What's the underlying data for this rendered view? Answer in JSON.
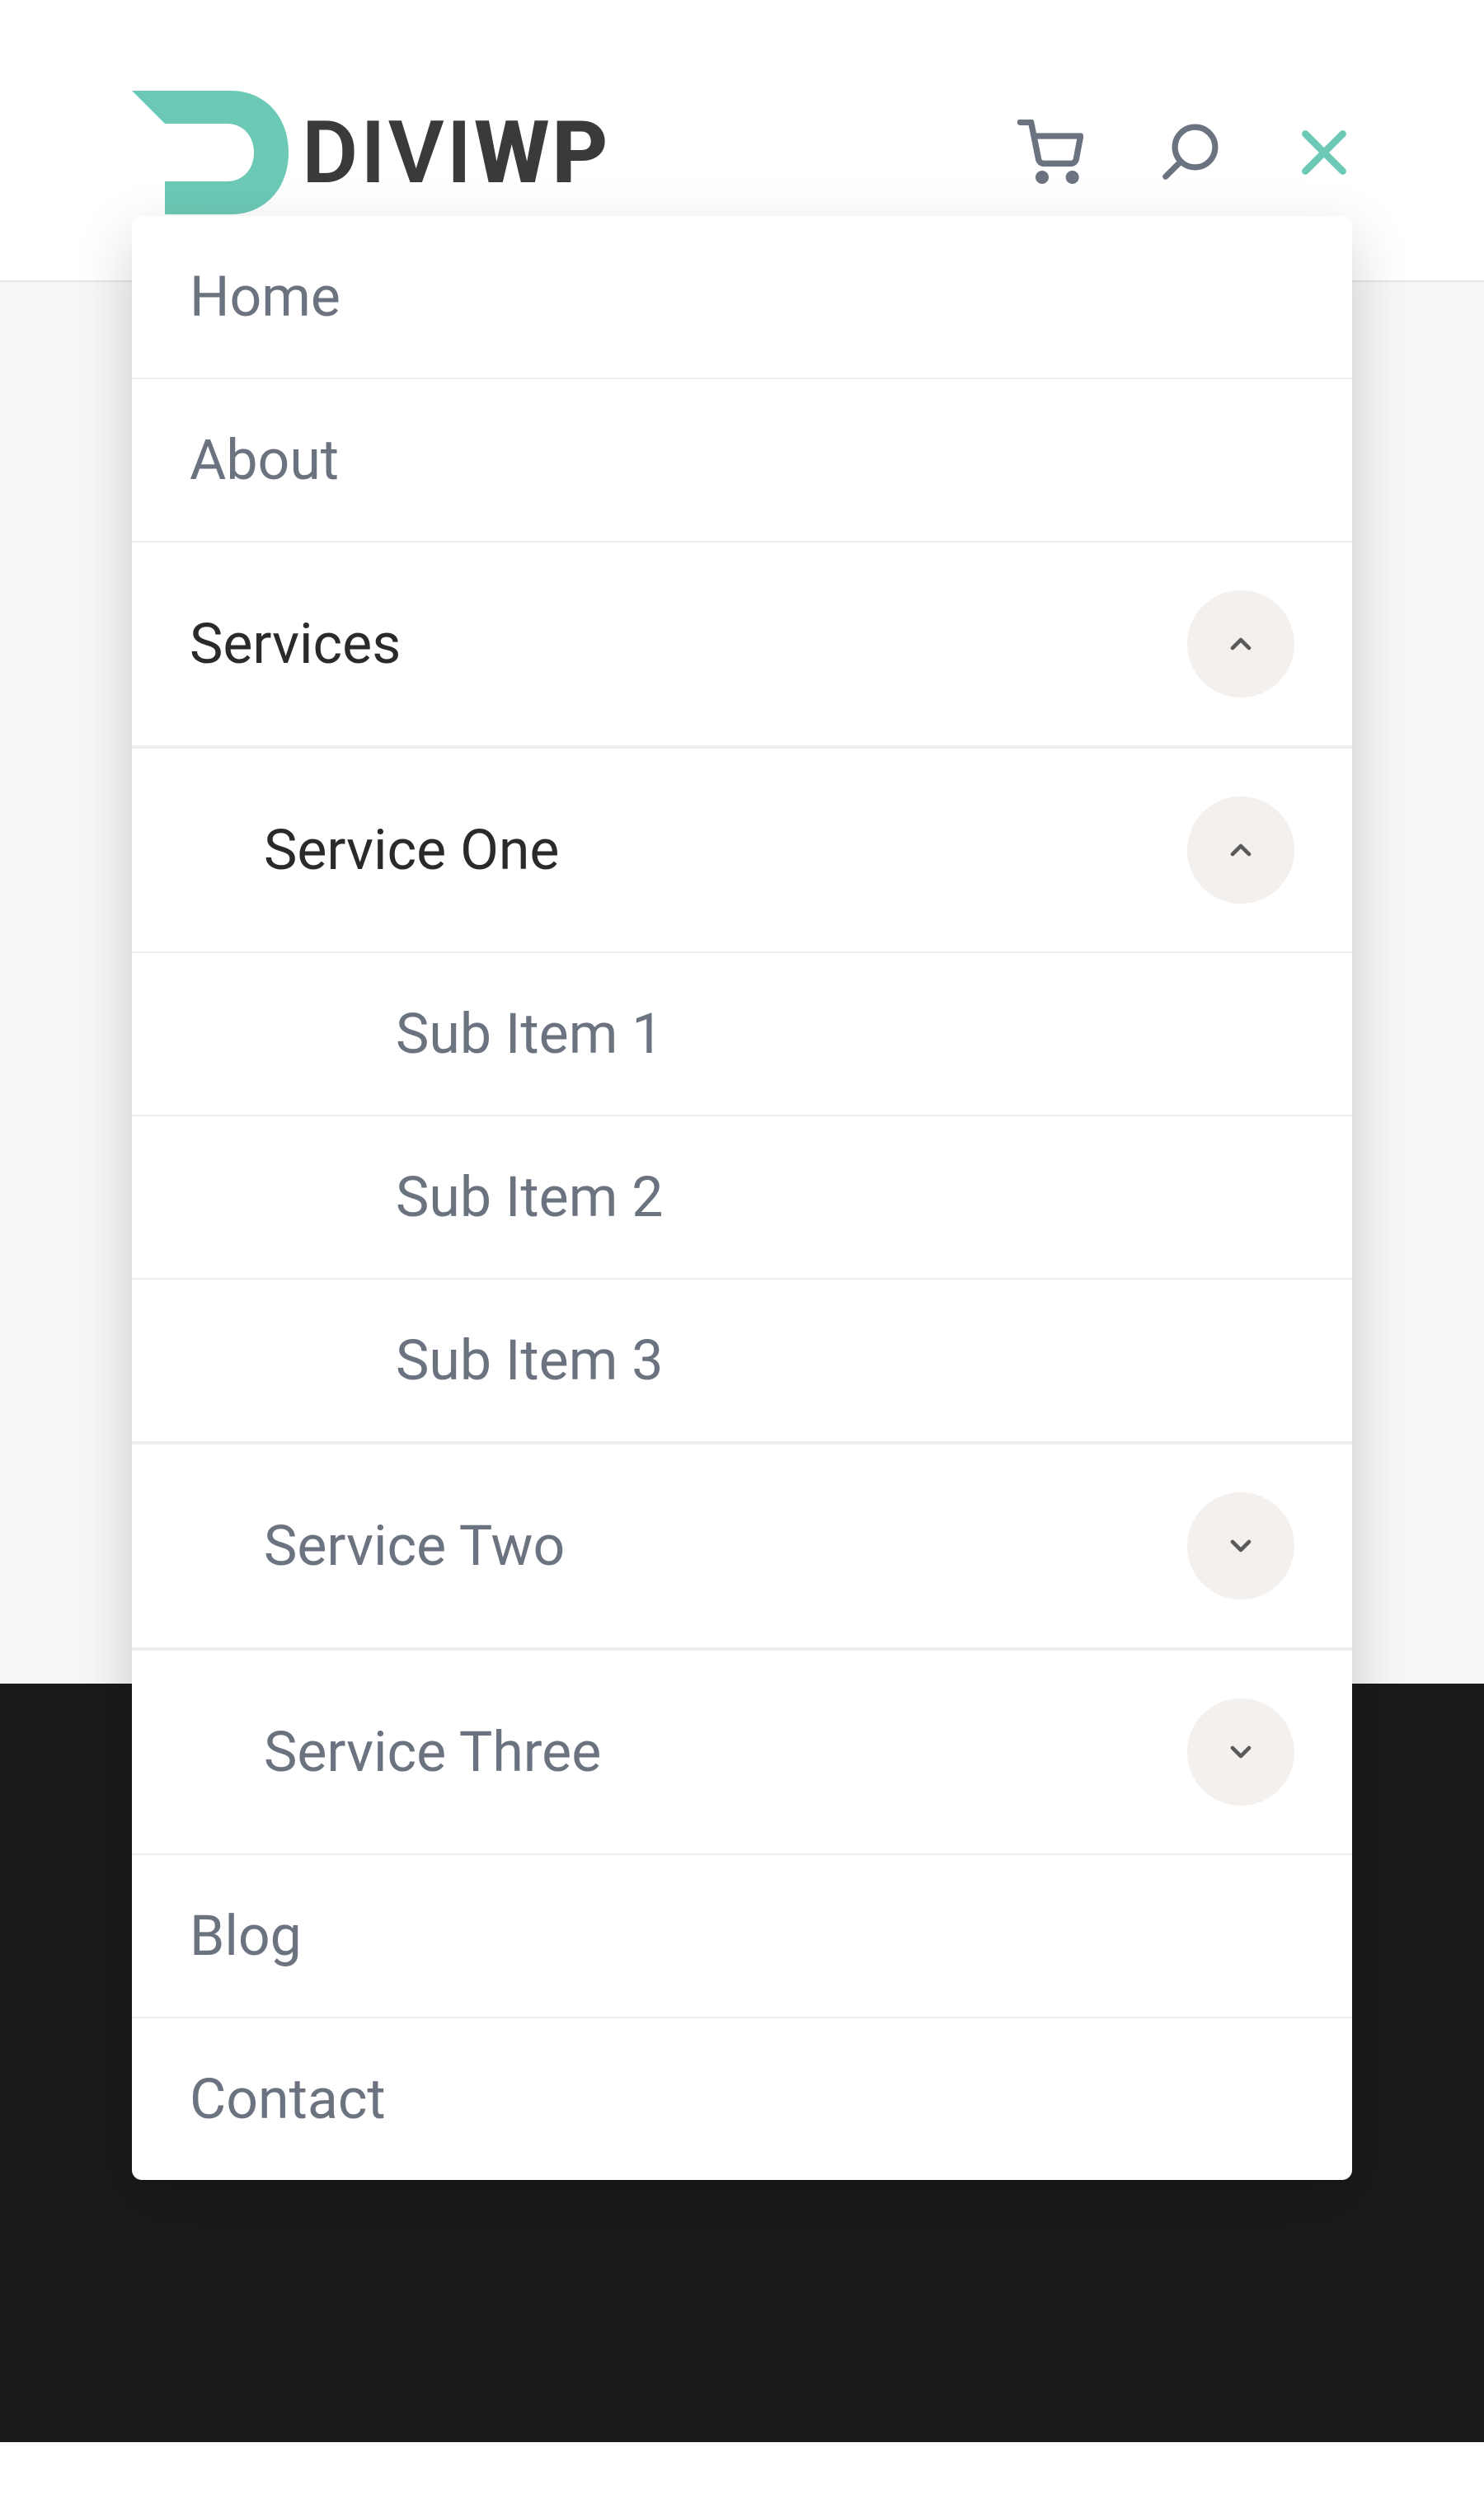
{
  "logo": {
    "text_part1": "DIVI",
    "text_part2": "WP"
  },
  "colors": {
    "accent": "#6cc9b5",
    "muted": "#6b7280",
    "dark": "#3a3a3a",
    "panel_bg": "#ffffff",
    "expand_bg": "#f3f0ee",
    "close_icon": "#6cc9b5",
    "icon_muted": "#6b7280"
  },
  "menu": {
    "items": [
      {
        "label": "Home",
        "active": false,
        "expandable": false
      },
      {
        "label": "About",
        "active": false,
        "expandable": false
      },
      {
        "label": "Services",
        "active": true,
        "expandable": true,
        "expanded": true,
        "children": [
          {
            "label": "Service One",
            "active": true,
            "expandable": true,
            "expanded": true,
            "children": [
              {
                "label": "Sub Item 1",
                "active": false
              },
              {
                "label": "Sub Item 2",
                "active": false
              },
              {
                "label": "Sub Item 3",
                "active": false
              }
            ]
          },
          {
            "label": "Service Two",
            "active": false,
            "expandable": true,
            "expanded": false
          },
          {
            "label": "Service Three",
            "active": false,
            "expandable": true,
            "expanded": false
          }
        ]
      },
      {
        "label": "Blog",
        "active": false,
        "expandable": false
      },
      {
        "label": "Contact",
        "active": false,
        "expandable": false
      }
    ]
  }
}
